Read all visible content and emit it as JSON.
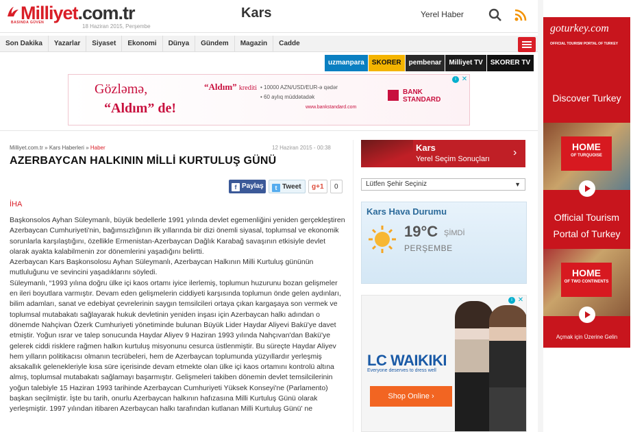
{
  "header": {
    "logo_main": "Milliyet",
    "logo_domain": ".com.tr",
    "logo_slogan": "BASINDA GÜVEN",
    "date": "18 Haziran 2015, Perşembe",
    "city": "Kars",
    "local_news": "Yerel Haber"
  },
  "nav": {
    "items": [
      "Son Dakika",
      "Yazarlar",
      "Siyaset",
      "Ekonomi",
      "Dünya",
      "Gündem",
      "Magazin",
      "Cadde"
    ]
  },
  "subsites": [
    {
      "label": "uzmanpara",
      "color": "#0a7fc1"
    },
    {
      "label": "SKORER",
      "color": "#f4b400",
      "text": "#111"
    },
    {
      "label": "pembenar",
      "color": "#2a2a2a"
    },
    {
      "label": "Milliyet TV",
      "color": "#1c1c1c"
    },
    {
      "label": "SKORER TV",
      "color": "#111"
    }
  ],
  "top_ad": {
    "line1": "Gözləmə,",
    "line2": "“Aldım” de!",
    "headline": "“Aldım”",
    "headline_sub": "krediti",
    "bullet1": "• 10000 AZN/USD/EUR-ə qədər",
    "bullet2": "• 60 aylıq müddətadək",
    "url": "www.bankstandard.com",
    "bank": "BANK STANDARD"
  },
  "article": {
    "breadcrumb_site": "Milliyet.com.tr",
    "breadcrumb_sep": "»",
    "breadcrumb_cat": "Kars Haberleri",
    "breadcrumb_cur": "Haber",
    "date": "12 Haziran 2015 - 00:38",
    "title": "AZERBAYCAN HALKININ MİLLİ KURTULUŞ GÜNÜ",
    "share_fb": "Paylaş",
    "share_tw": "Tweet",
    "share_gp": "g+1",
    "share_count": "0",
    "source": "İHA",
    "paragraphs": [
      "Başkonsolos Ayhan Süleymanlı, büyük bedellerle 1991 yılında devlet egemenliğini yeniden gerçekleştiren Azerbaycan Cumhuriyeti'nin, bağımsızlığının ilk yıllarında bir dizi önemli siyasal, toplumsal ve ekonomik sorunlarla karşılaştığını, özellikle Ermenistan-Azerbaycan Dağlık Karabağ savaşının etkisiyle devlet olarak ayakta kalabilmenin zor dönemlerini yaşadığını belirtti.",
      "Azerbaycan Kars Başkonsolosu Ayhan Süleymanlı, Azerbaycan Halkının Milli Kurtuluş gününün mutluluğunu ve sevincini yaşadıklarını söyledi.",
      "Süleymanlı, “1993 yılına doğru ülke içi kaos ortamı iyice ilerlemiş, toplumun huzurunu bozan gelişmeler en ileri boyutlara varmıştır. Devam eden gelişmelerin ciddiyeti karşısında toplumun önde gelen aydınları, bilim adamları, sanat ve edebiyat çevrelerinin saygın temsilcileri ortaya çıkan kargaşaya son vermek ve toplumsal mutabakatı sağlayarak hukuk devletinin yeniden inşası için Azerbaycan halkı adından o dönemde Nahçivan Özerk Cumhuriyeti yönetiminde bulunan Büyük Lider Haydar Aliyevi Bakü'ye davet etmiştir. Yoğun ısrar ve talep sonucunda Haydar Aliyev 9 Haziran 1993 yılında Nahçıvan'dan Bakü'ye gelerek ciddi risklere rağmen halkın kurtuluş misyonunu cesurca üstlenmiştir. Bu süreçte Haydar Aliyev hem yılların politikacısı olmanın tecrübeleri, hem de Azerbaycan toplumunda yüzyıllardır yerleşmiş aksakallık gelenekleriyle kısa süre içerisinde devam etmekte olan ülke içi kaos ortamını kontrolü altına almış, toplumsal mutabakatı sağlamayı başarmıştır. Gelişmeleri takiben dönemin devlet temsilcilerinin yoğun talebiyle 15 Haziran 1993 tarihinde Azerbaycan Cumhuriyeti Yüksek Konseyi'ne (Parlamento) başkan seçilmiştir. İşte bu tarih, onurlu Azerbaycan halkının hafızasına Milli Kurtuluş Günü olarak yerleşmiştir. 1997 yılından itibaren Azerbaycan halkı tarafından kutlanan Milli Kurtuluş Günü' ne"
    ]
  },
  "sidebar": {
    "kars_title": "Kars",
    "kars_sub": "Yerel Seçim Sonuçları",
    "select_placeholder": "Lütfen Şehir Seçiniz",
    "weather_title": "Kars Hava Durumu",
    "weather_temp": "19°C",
    "weather_now": "ŞİMDİ",
    "weather_day": "PERŞEMBE",
    "lc_brand": "LC WAIKIKI",
    "lc_slogan": "Everyone deserves to dress well",
    "lc_button": "Shop Online ›"
  },
  "sky_ad": {
    "brand": "goturkey.com",
    "brand_sub": "OFFICIAL TOURISM PORTAL OF TURKEY",
    "discover": "Discover Turkey",
    "home1": "HOME",
    "home1_sub": "OF TURQUOISE",
    "official": "Official Tourism Portal of Turkey",
    "home2": "HOME",
    "home2_sub": "OF TWO CONTINENTS",
    "open": "Açmak için Üzerine Gelin"
  }
}
